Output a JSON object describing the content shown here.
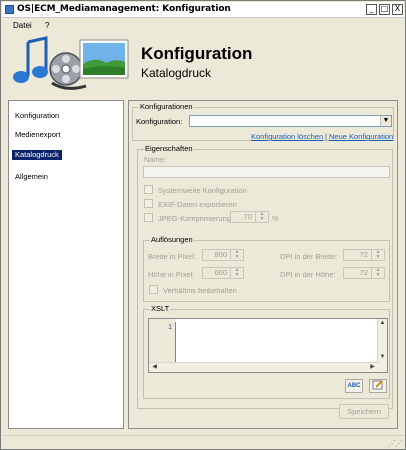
{
  "window": {
    "title": "OS|ECM_Mediamanagement: Konfiguration",
    "minimize": "_",
    "maximize": "□",
    "close": "X"
  },
  "menu": [
    "Datei",
    "?"
  ],
  "header": {
    "title": "Konfiguration",
    "subtitle": "Katalogdruck",
    "icons": [
      "music-note-icon",
      "film-reel-icon",
      "landscape-image-icon"
    ]
  },
  "sidebar": {
    "items": [
      {
        "label": "Konfiguration",
        "active": false
      },
      {
        "label": "Medienexport",
        "active": false
      },
      {
        "label": "Katalogdruck",
        "active": true
      },
      {
        "label": "Allgemein",
        "active": false
      }
    ]
  },
  "konfigurationen": {
    "group_label": "Konfigurationen",
    "label": "Konfiguration:",
    "value": "",
    "delete_link": "Konfiguration löschen",
    "separator": "|",
    "new_link": "Neue Konfiguration"
  },
  "eigenschaften": {
    "group_label": "Eigenschaften",
    "name_label": "Name:",
    "name_value": "",
    "systemweit_label": "Systemweite Konfiguration",
    "exif_label": "EXIF-Daten exportieren",
    "jpeg_label": "JPEG-Komprimierung:",
    "jpeg_value": "70",
    "jpeg_unit": "%"
  },
  "aufloesungen": {
    "group_label": "Auflösungen",
    "breite_label": "Breite in Pixel:",
    "breite_value": "800",
    "hoehe_label": "Höhe in Pixel:",
    "hoehe_value": "600",
    "dpi_breite_label": "DPI in der Breite:",
    "dpi_breite_value": "72",
    "dpi_hoehe_label": "DPI in der Höhe:",
    "dpi_hoehe_value": "72",
    "ratio_label": "Verhältnis beibehalten"
  },
  "xslt": {
    "group_label": "XSLT",
    "line_number": "1",
    "spellcheck_label": "ABC"
  },
  "save_button": "Speichern",
  "colors": {
    "window_bg": "#ece9d8",
    "selection": "#0a246a",
    "link": "#1a5fb4"
  }
}
